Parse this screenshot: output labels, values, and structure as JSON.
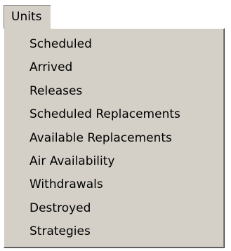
{
  "menu": {
    "title": "Units",
    "items": [
      {
        "label": "Scheduled"
      },
      {
        "label": "Arrived"
      },
      {
        "label": "Releases"
      },
      {
        "label": "Scheduled Replacements"
      },
      {
        "label": "Available Replacements"
      },
      {
        "label": "Air Availability"
      },
      {
        "label": "Withdrawals"
      },
      {
        "label": "Destroyed"
      },
      {
        "label": "Strategies"
      }
    ]
  }
}
